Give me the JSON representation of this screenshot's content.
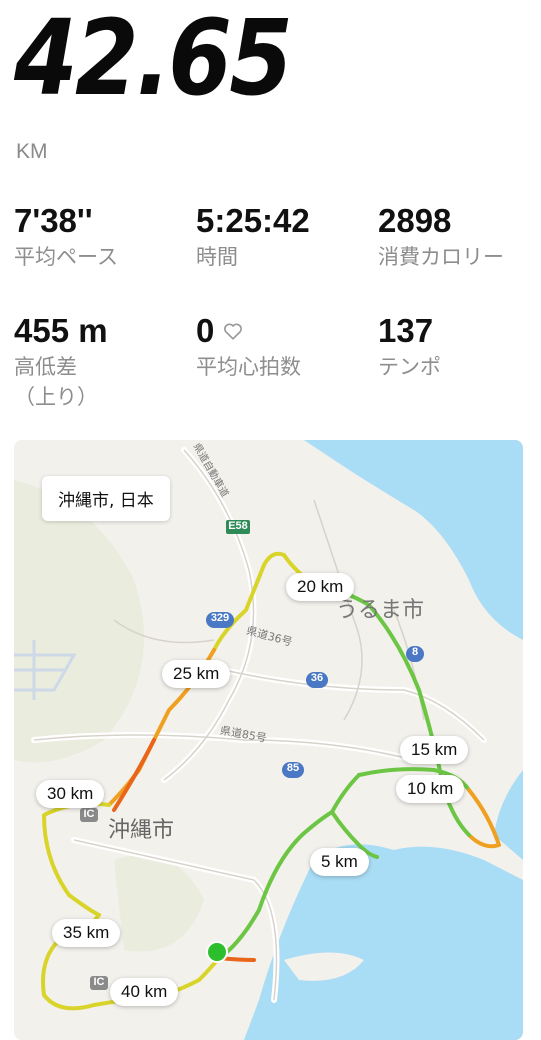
{
  "summary": {
    "distance": "42.65",
    "distance_unit": "KM"
  },
  "stats": [
    {
      "value": "7'38''",
      "label": "平均ペース"
    },
    {
      "value": "5:25:42",
      "label": "時間"
    },
    {
      "value": "2898",
      "label": "消費カロリー"
    },
    {
      "value": "455 m",
      "label": "高低差\n（上り）"
    },
    {
      "value": "0",
      "label": "平均心拍数",
      "icon": "heart-outline-icon"
    },
    {
      "value": "137",
      "label": "テンポ"
    }
  ],
  "map": {
    "location": "沖縄市, 日本",
    "city_labels": [
      "うるま市",
      "沖縄市"
    ],
    "road_labels": [
      "県道36号",
      "県道85号",
      "県道自動車道"
    ],
    "road_shields": [
      "E58",
      "329",
      "36",
      "8",
      "85",
      "IC",
      "IC"
    ],
    "km_markers": [
      "5 km",
      "10 km",
      "15 km",
      "20 km",
      "25 km",
      "30 km",
      "35 km",
      "40 km"
    ],
    "route_colors": {
      "good": "#6cc644",
      "mid": "#d9d42a",
      "warm": "#f0a020",
      "slow": "#e8651a",
      "start": "#2dbe2d"
    },
    "water_color": "#a9dcf5",
    "land_color": "#f3f1ec"
  }
}
